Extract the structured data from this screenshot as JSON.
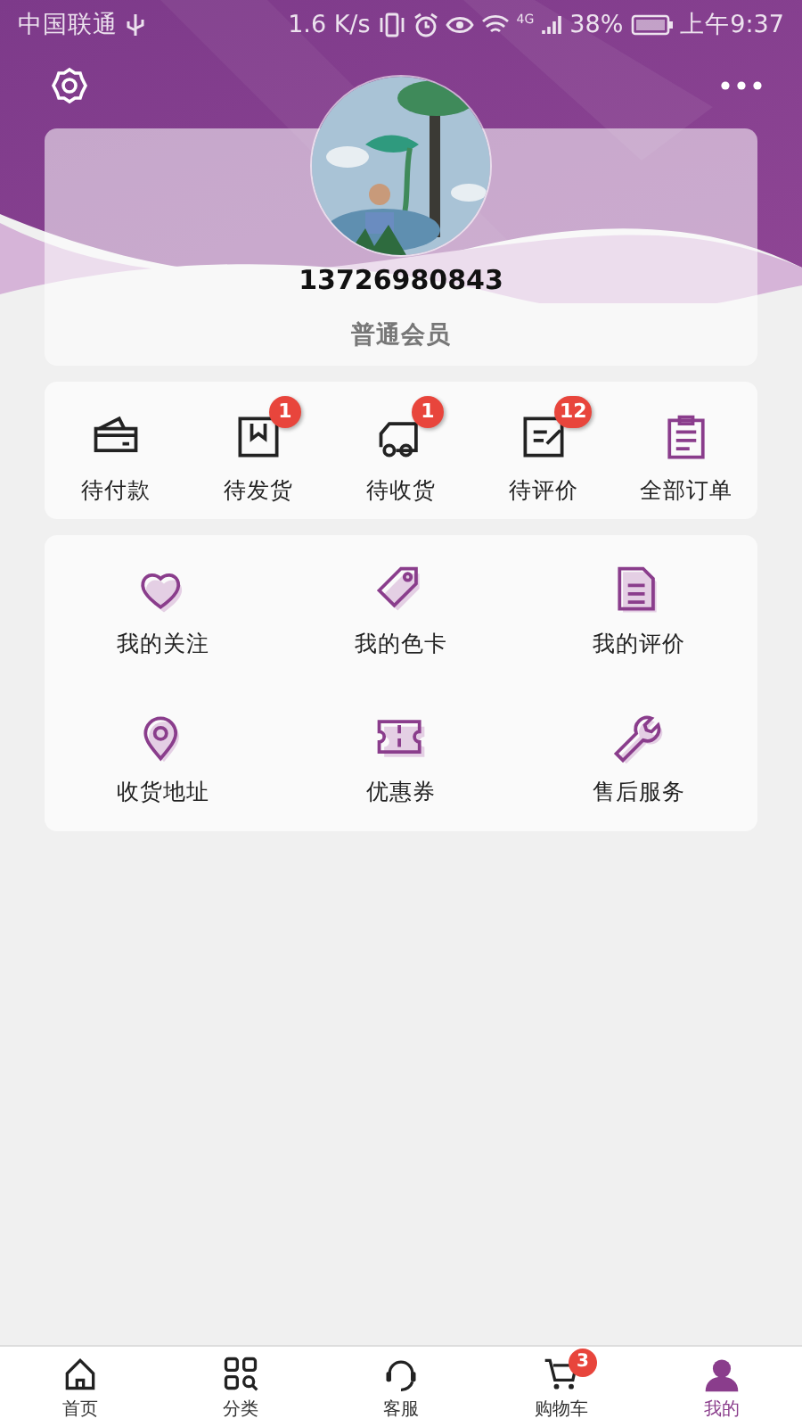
{
  "status_bar": {
    "carrier": "中国联通",
    "speed": "1.6 K/s",
    "network": "4G",
    "battery": "38%",
    "time": "上午9:37"
  },
  "profile": {
    "phone": "13726980843",
    "member_level": "普通会员"
  },
  "orders": [
    {
      "label": "待付款",
      "kind": "card"
    },
    {
      "label": "待发货",
      "kind": "box",
      "badge": "1"
    },
    {
      "label": "待收货",
      "kind": "truck",
      "badge": "1"
    },
    {
      "label": "待评价",
      "kind": "note",
      "badge": "12"
    },
    {
      "label": "全部订单",
      "kind": "clipboard"
    }
  ],
  "services": [
    {
      "label": "我的关注",
      "kind": "heart"
    },
    {
      "label": "我的色卡",
      "kind": "tag"
    },
    {
      "label": "我的评价",
      "kind": "document"
    },
    {
      "label": "收货地址",
      "kind": "pin"
    },
    {
      "label": "优惠券",
      "kind": "ticket"
    },
    {
      "label": "售后服务",
      "kind": "wrench"
    }
  ],
  "tab_bar": [
    {
      "label": "首页",
      "kind": "home",
      "selected": false
    },
    {
      "label": "分类",
      "kind": "grid",
      "selected": false
    },
    {
      "label": "客服",
      "kind": "headset",
      "selected": false
    },
    {
      "label": "购物车",
      "kind": "cart",
      "selected": false,
      "badge": "3"
    },
    {
      "label": "我的",
      "kind": "user",
      "selected": true
    }
  ]
}
